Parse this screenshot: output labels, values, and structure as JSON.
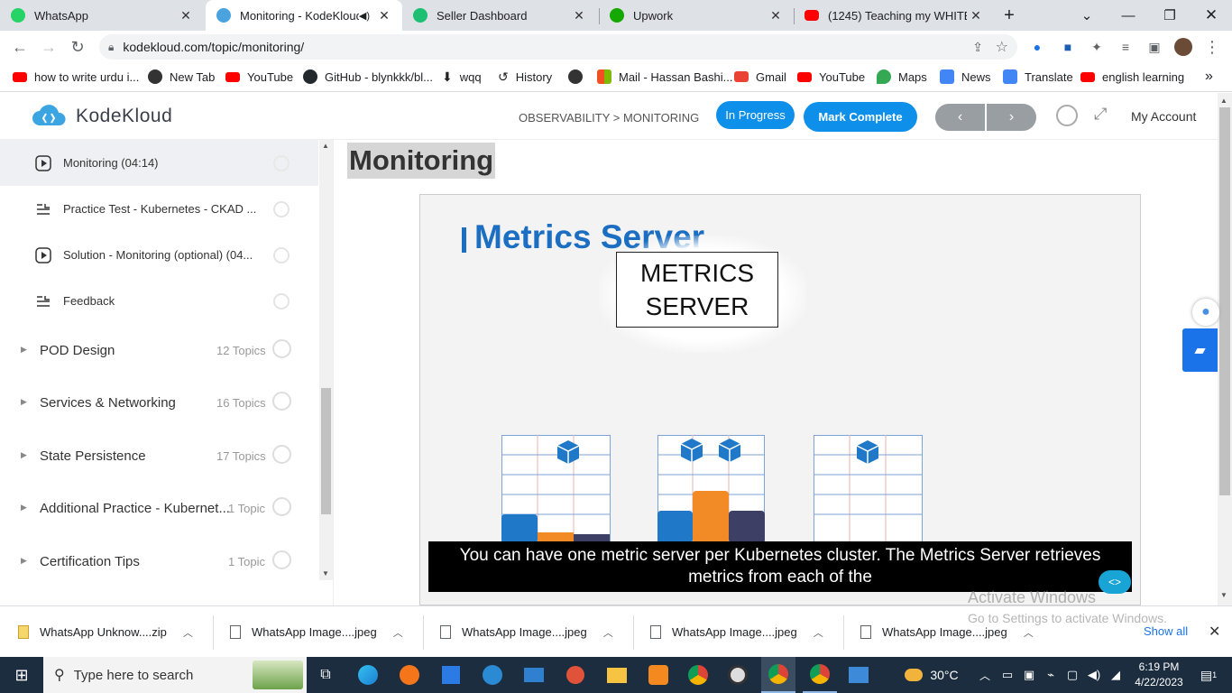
{
  "browser": {
    "tabs": [
      {
        "title": "WhatsApp",
        "icon": "whatsapp-icon",
        "color": "#25d366",
        "active": false
      },
      {
        "title": "Monitoring - KodeKloud",
        "icon": "kodekloud-icon",
        "color": "#4aa3df",
        "active": true
      },
      {
        "title": "Seller Dashboard",
        "icon": "seller-icon",
        "color": "#1dbf73",
        "active": false
      },
      {
        "title": "Upwork",
        "icon": "upwork-icon",
        "color": "#14a800",
        "active": false
      },
      {
        "title": "(1245) Teaching my WHITE fr",
        "icon": "youtube-icon",
        "color": "#ff0000",
        "active": false
      }
    ],
    "new_tab": "+",
    "url": "kodekloud.com/topic/monitoring/",
    "bookmarks": [
      {
        "label": "how to write urdu i...",
        "icon": "youtube-icon",
        "color": "#ff0000"
      },
      {
        "label": "New Tab",
        "icon": "newtab-icon",
        "color": "#333333"
      },
      {
        "label": "YouTube",
        "icon": "youtube-icon",
        "color": "#ff0000"
      },
      {
        "label": "GitHub - blynkkk/bl...",
        "icon": "github-icon",
        "color": "#24292e"
      },
      {
        "label": "wqq",
        "icon": "download-icon",
        "color": "#444444"
      },
      {
        "label": "History",
        "icon": "history-icon",
        "color": "#444444"
      },
      {
        "label": "",
        "icon": "globe-icon",
        "color": "#333333"
      },
      {
        "label": "Mail - Hassan Bashi...",
        "icon": "microsoft-icon",
        "color": "#f25022"
      },
      {
        "label": "Gmail",
        "icon": "gmail-icon",
        "color": "#ea4335"
      },
      {
        "label": "YouTube",
        "icon": "youtube-icon",
        "color": "#ff0000"
      },
      {
        "label": "Maps",
        "icon": "maps-icon",
        "color": "#34a853"
      },
      {
        "label": "News",
        "icon": "news-icon",
        "color": "#4285f4"
      },
      {
        "label": "Translate",
        "icon": "translate-icon",
        "color": "#4285f4"
      },
      {
        "label": "english learning",
        "icon": "youtube-icon",
        "color": "#ff0000"
      }
    ]
  },
  "site": {
    "logo_text": "KodeKloud",
    "breadcrumb": "OBSERVABILITY > MONITORING",
    "status_button": "In Progress",
    "complete_button": "Mark Complete",
    "account": "My Account",
    "accent": "#0e90ea"
  },
  "sidebar": {
    "lessons": [
      {
        "title": "Monitoring (04:14)",
        "type": "video",
        "current": true
      },
      {
        "title": "Practice Test - Kubernetes - CKAD ...",
        "type": "list",
        "current": false
      },
      {
        "title": "Solution - Monitoring (optional) (04...",
        "type": "video",
        "current": false
      },
      {
        "title": "Feedback",
        "type": "list",
        "current": false
      }
    ],
    "sections": [
      {
        "title": "POD Design",
        "count": "12 Topics"
      },
      {
        "title": "Services & Networking",
        "count": "16 Topics"
      },
      {
        "title": "State Persistence",
        "count": "17 Topics"
      },
      {
        "title": "Additional Practice - Kubernet...",
        "count": "1 Topic"
      },
      {
        "title": "Certification Tips",
        "count": "1 Topic"
      }
    ]
  },
  "main": {
    "title": "Monitoring",
    "video": {
      "slide_title": "Metrics Server",
      "box_label_1": "METRICS",
      "box_label_2": "SERVER",
      "caption_1": "You can have one metric server per Kubernetes cluster. The Metrics Server retrieves",
      "caption_2": "metrics from each of the"
    }
  },
  "watermark": {
    "line1": "Activate Windows",
    "line2": "Go to Settings to activate Windows."
  },
  "downloads": {
    "items": [
      {
        "name": "WhatsApp Unknow....zip"
      },
      {
        "name": "WhatsApp Image....jpeg"
      },
      {
        "name": "WhatsApp Image....jpeg"
      },
      {
        "name": "WhatsApp Image....jpeg"
      },
      {
        "name": "WhatsApp Image....jpeg"
      }
    ],
    "show_all": "Show all"
  },
  "taskbar": {
    "search_placeholder": "Type here to search",
    "weather": "30°C",
    "time": "6:19 PM",
    "date": "4/22/2023",
    "notifications": "1"
  }
}
